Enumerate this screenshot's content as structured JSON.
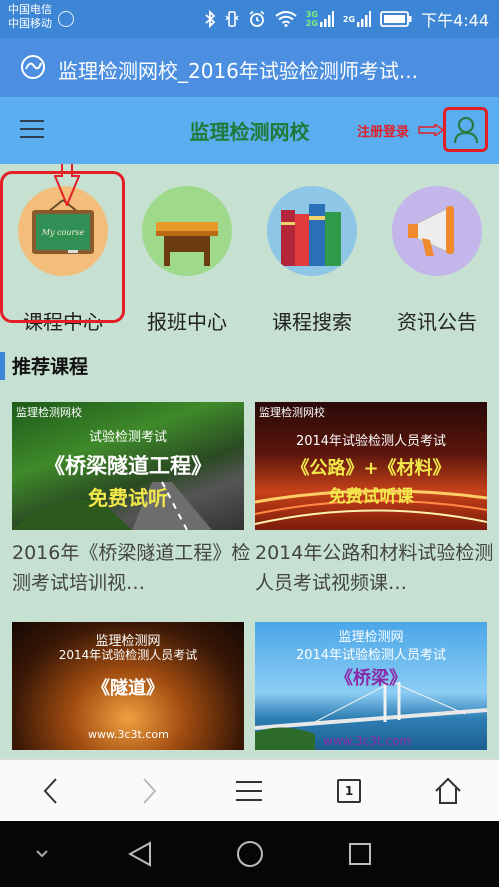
{
  "status_bar": {
    "carrier_1": "中国电信",
    "carrier_2": "中国移动",
    "net_badge_1": "3G",
    "net_badge_2": "2G",
    "net_badge_3": "2G",
    "time": "下午4:44"
  },
  "browser": {
    "page_title": "监理检测网校_2016年试验检测师考试...",
    "tab_count": "1"
  },
  "header": {
    "site_title": "监理检测网校",
    "register_login": "注册登录"
  },
  "nav": {
    "items": [
      {
        "label": "课程中心",
        "icon": "chalkboard-icon",
        "board_text": "My course"
      },
      {
        "label": "报班中心",
        "icon": "desk-icon"
      },
      {
        "label": "课程搜索",
        "icon": "books-icon"
      },
      {
        "label": "资讯公告",
        "icon": "megaphone-icon"
      }
    ]
  },
  "recommended": {
    "title": "推荐课程",
    "courses": [
      {
        "brand": "监理检测网校",
        "line1": "试验检测考试",
        "line2": "《桥梁隧道工程》",
        "line3": "免费试听",
        "caption": "2016年《桥梁隧道工程》检测考试培训视…"
      },
      {
        "brand": "监理检测网校",
        "line1": "2014年试验检测人员考试",
        "line2": "《公路》+《材料》",
        "line3": "免费试听课",
        "caption": "2014年公路和材料试验检测人员考试视频课…"
      },
      {
        "line1": "监理检测网",
        "line1b": "2014年试验检测人员考试",
        "line2": "《隧道》",
        "url": "www.3c3t.com"
      },
      {
        "line1": "监理检测网",
        "line1b": "2014年试验检测人员考试",
        "line2": "《桥梁》",
        "url": "www.3c3t.com"
      }
    ]
  },
  "colors": {
    "status_bar": "#3d86d6",
    "header": "#5aaef0",
    "main_bg": "#c6e1d2",
    "highlight": "#e31e24",
    "site_title": "#1f7a3a"
  }
}
